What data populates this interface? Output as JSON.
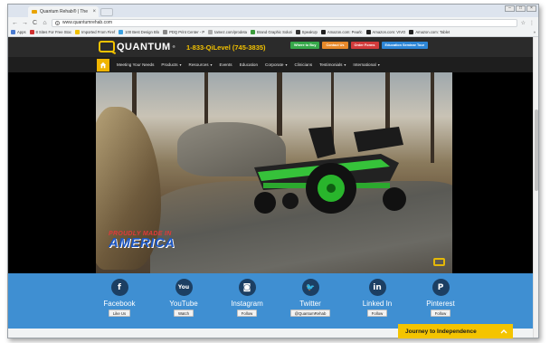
{
  "browser": {
    "tab_title": "Quantum Rehab® | The",
    "tab_close": "×",
    "url": "www.quantumrehab.com",
    "window_controls": [
      "–",
      "□",
      "×"
    ],
    "nav": {
      "back": "←",
      "forward": "→",
      "reload": "C",
      "home": "⌂"
    },
    "star": "☆",
    "menu": "⋮",
    "bookmarks": [
      {
        "label": "Apps",
        "color": "#4a7bd0"
      },
      {
        "label": "8 Sites For Free Stoc",
        "color": "#d03030"
      },
      {
        "label": "Imported From Firef",
        "color": "#f0c000"
      },
      {
        "label": "100 Best Design Blo",
        "color": "#3aa0e0"
      },
      {
        "label": "PDQ Print Center - P",
        "color": "#888888"
      },
      {
        "label": "tamez.com/prodeta",
        "color": "#aaaaaa"
      },
      {
        "label": "Brand Graphic Soluti",
        "color": "#3b9b3b"
      },
      {
        "label": "SpeakUp",
        "color": "#333333"
      },
      {
        "label": "Amazon.com: Pearlc",
        "color": "#222222"
      },
      {
        "label": "Amazon.com: VIVO",
        "color": "#222222"
      },
      {
        "label": "Amazon.com: Tablet",
        "color": "#222222"
      }
    ],
    "bookmarks_more": "»"
  },
  "header": {
    "logo_text": "QUANTUM",
    "logo_reg": "®",
    "phone": "1-833-QiLevel (745-3835)",
    "buttons": [
      {
        "label": "Where to Buy",
        "color": "#36a84a"
      },
      {
        "label": "Contact Us",
        "color": "#e8892a"
      },
      {
        "label": "Order Forms",
        "color": "#d23b3b"
      },
      {
        "label": "Education Seminar Tour",
        "color": "#2d86d6"
      }
    ]
  },
  "nav": {
    "items": [
      {
        "label": "Meeting Your Needs",
        "dropdown": false
      },
      {
        "label": "Products",
        "dropdown": true
      },
      {
        "label": "Resources",
        "dropdown": true
      },
      {
        "label": "Events",
        "dropdown": false
      },
      {
        "label": "Education",
        "dropdown": false
      },
      {
        "label": "Corporate",
        "dropdown": true
      },
      {
        "label": "Clinicians",
        "dropdown": false
      },
      {
        "label": "Testimonials",
        "dropdown": true
      },
      {
        "label": "International",
        "dropdown": true
      }
    ],
    "dropdown_glyph": "▾"
  },
  "video": {
    "watermark_top": "PROUDLY MADE IN",
    "watermark_bottom": "AMERICA"
  },
  "social": {
    "items": [
      {
        "name": "Facebook",
        "button": "Like Us",
        "glyph": "f"
      },
      {
        "name": "YouTube",
        "button": "Watch",
        "glyph": "You"
      },
      {
        "name": "Instagram",
        "button": "Follow",
        "glyph": "◙"
      },
      {
        "name": "Twitter",
        "button": "@QuantumRehab",
        "glyph": "🐦"
      },
      {
        "name": "Linked In",
        "button": "Follow",
        "glyph": "in"
      },
      {
        "name": "Pinterest",
        "button": "Follow",
        "glyph": "P"
      }
    ]
  },
  "journey": {
    "label": "Journey to Independence"
  }
}
